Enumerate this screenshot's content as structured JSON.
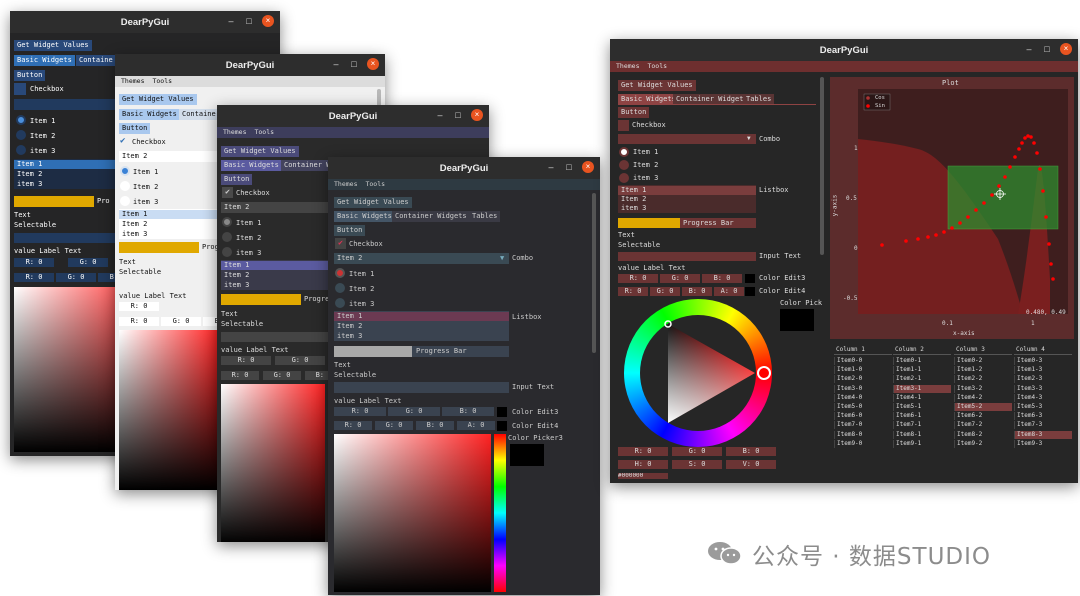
{
  "window_title": "DearPyGui",
  "menu": {
    "themes": "Themes",
    "tools": "Tools"
  },
  "title_controls": {
    "minimize": "–",
    "maximize": "□",
    "close": "×"
  },
  "widgets": {
    "get_values": "Get Widget Values",
    "tab_basic": "Basic Widgets",
    "tab_container": "Container Widgets",
    "tab_container_short": "Containe",
    "tab_container_w": "Container W",
    "tab_container_label": "Container",
    "tab_tables": "Tables",
    "button": "Button",
    "checkbox": "Checkbox",
    "combo_value": "Item 2",
    "combo_label": "Combo",
    "radio": [
      "Item 1",
      "Item 2",
      "item 3"
    ],
    "listbox": [
      "Item 1",
      "Item 2",
      "item 3"
    ],
    "listbox_label": "Listbox",
    "progress_label": "Progress Bar",
    "progress_short": "Pro",
    "progress_mid": "Progre",
    "progress_mid2": "Prog",
    "text": "Text",
    "selectable": "Selectable",
    "input_text_label": "Input Text",
    "value_label": "value",
    "label_text": "Label Text",
    "rgb": {
      "r": "R:  0",
      "g": "G:  0",
      "b": "B:  0",
      "a": "A:  0"
    },
    "hsv": {
      "h": "H:  0",
      "s": "S:  0",
      "v": "V:  0"
    },
    "hex": "#000000",
    "color_edit3": "Color Edit3",
    "color_edit4": "Color Edit4",
    "color_picker3": "Color Picker3",
    "color_pick_short": "Color Pick"
  },
  "plot": {
    "title": "Plot",
    "xlabel": "x-axis",
    "ylabel": "y-axis",
    "legend": [
      "Cos",
      "Sin"
    ],
    "y_ticks": [
      "1",
      "0.5",
      "0",
      "-0.5"
    ],
    "x_ticks": [
      "0.1",
      "1"
    ],
    "coord_readout": "0.480, 0.49"
  },
  "table": {
    "headers": [
      "Column 1",
      "Column 2",
      "Column 3",
      "Column 4"
    ],
    "rows": [
      [
        "Item0-0",
        "Item0-1",
        "Item0-2",
        "Item0-3"
      ],
      [
        "Item1-0",
        "Item1-1",
        "Item1-2",
        "Item1-3"
      ],
      [
        "Item2-0",
        "Item2-1",
        "Item2-2",
        "Item2-3"
      ],
      [
        "Item3-0",
        "Item3-1",
        "Item3-2",
        "Item3-3"
      ],
      [
        "Item4-0",
        "Item4-1",
        "Item4-2",
        "Item4-3"
      ],
      [
        "Item5-0",
        "Item5-1",
        "Item5-2",
        "Item5-3"
      ],
      [
        "Item6-0",
        "Item6-1",
        "Item6-2",
        "Item6-3"
      ],
      [
        "Item7-0",
        "Item7-1",
        "Item7-2",
        "Item7-3"
      ],
      [
        "Item8-0",
        "Item8-1",
        "Item8-2",
        "Item8-3"
      ],
      [
        "Item9-0",
        "Item9-1",
        "Item9-2",
        "Item9-3"
      ]
    ]
  },
  "watermark": "公众号 · 数据STUDIO",
  "colors": {
    "accent_blue": "#2f6fb5",
    "accent_yellow": "#e0a800",
    "accent_red": "#9a3b3b",
    "close": "#e95420"
  }
}
